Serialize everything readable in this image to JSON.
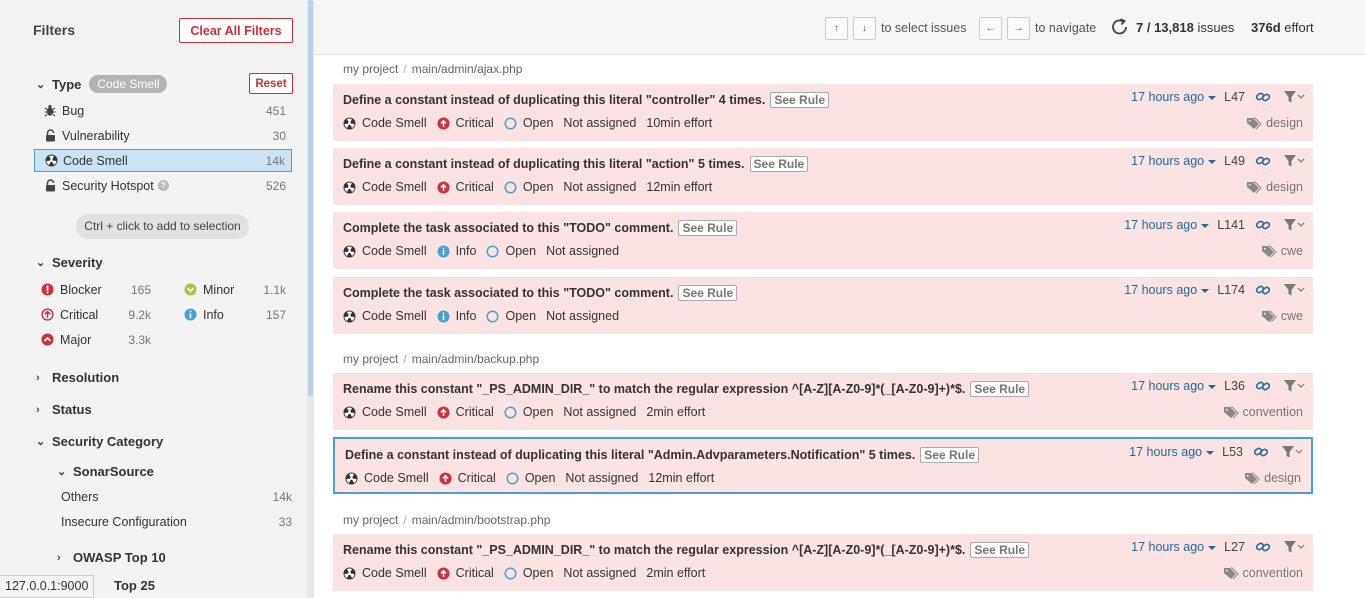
{
  "sidebar": {
    "title": "Filters",
    "clear_label": "Clear All Filters",
    "type": {
      "title": "Type",
      "tag": "Code Smell",
      "reset_label": "Reset",
      "items": [
        {
          "label": "Bug",
          "count": "451",
          "icon": "bug-icon"
        },
        {
          "label": "Vulnerability",
          "count": "30",
          "icon": "lock-icon"
        },
        {
          "label": "Code Smell",
          "count": "14k",
          "icon": "code-smell-icon"
        },
        {
          "label": "Security Hotspot",
          "count": "526",
          "icon": "lock-icon"
        }
      ],
      "hint": "Ctrl + click to add to selection"
    },
    "severity": {
      "title": "Severity",
      "items": [
        {
          "label": "Blocker",
          "count": "165"
        },
        {
          "label": "Minor",
          "count": "1.1k"
        },
        {
          "label": "Critical",
          "count": "9.2k"
        },
        {
          "label": "Info",
          "count": "157"
        },
        {
          "label": "Major",
          "count": "3.3k"
        }
      ]
    },
    "resolution_title": "Resolution",
    "status_title": "Status",
    "security_category": {
      "title": "Security Category",
      "sonarsource": {
        "title": "SonarSource",
        "items": [
          {
            "label": "Others",
            "count": "14k"
          },
          {
            "label": "Insecure Configuration",
            "count": "33"
          }
        ]
      },
      "owasp_title": "OWASP Top 10",
      "top25_title": "Top 25"
    },
    "url_tip": "127.0.0.1:9000"
  },
  "topbar": {
    "up_key": "↑",
    "down_key": "↓",
    "select_hint": "to select issues",
    "left_key": "←",
    "right_key": "→",
    "navigate_hint": "to navigate",
    "issues_count": "7 / 13,818",
    "issues_label": "issues",
    "effort_value": "376d",
    "effort_label": "effort"
  },
  "groups": [
    {
      "project": "my project",
      "file": "main/admin/ajax.php",
      "issues": [
        {
          "message": "Define a constant instead of duplicating this literal \"controller\" 4 times.",
          "type": "Code Smell",
          "severity": "Critical",
          "status": "Open",
          "assignee": "Not assigned",
          "effort": "10min effort",
          "ago": "17 hours ago",
          "line": "L47",
          "tag": "design"
        },
        {
          "message": "Define a constant instead of duplicating this literal \"action\" 5 times.",
          "type": "Code Smell",
          "severity": "Critical",
          "status": "Open",
          "assignee": "Not assigned",
          "effort": "12min effort",
          "ago": "17 hours ago",
          "line": "L49",
          "tag": "design"
        },
        {
          "message": "Complete the task associated to this \"TODO\" comment.",
          "type": "Code Smell",
          "severity": "Info",
          "status": "Open",
          "assignee": "Not assigned",
          "effort": "",
          "ago": "17 hours ago",
          "line": "L141",
          "tag": "cwe"
        },
        {
          "message": "Complete the task associated to this \"TODO\" comment.",
          "type": "Code Smell",
          "severity": "Info",
          "status": "Open",
          "assignee": "Not assigned",
          "effort": "",
          "ago": "17 hours ago",
          "line": "L174",
          "tag": "cwe"
        }
      ]
    },
    {
      "project": "my project",
      "file": "main/admin/backup.php",
      "issues": [
        {
          "message": "Rename this constant \"_PS_ADMIN_DIR_\" to match the regular expression ^[A-Z][A-Z0-9]*(_[A-Z0-9]+)*$.",
          "type": "Code Smell",
          "severity": "Critical",
          "status": "Open",
          "assignee": "Not assigned",
          "effort": "2min effort",
          "ago": "17 hours ago",
          "line": "L36",
          "tag": "convention"
        },
        {
          "message": "Define a constant instead of duplicating this literal \"Admin.Advparameters.Notification\" 5 times.",
          "type": "Code Smell",
          "severity": "Critical",
          "status": "Open",
          "assignee": "Not assigned",
          "effort": "12min effort",
          "ago": "17 hours ago",
          "line": "L53",
          "tag": "design"
        }
      ]
    },
    {
      "project": "my project",
      "file": "main/admin/bootstrap.php",
      "issues": [
        {
          "message": "Rename this constant \"_PS_ADMIN_DIR_\" to match the regular expression ^[A-Z][A-Z0-9]*(_[A-Z0-9]+)*$.",
          "type": "Code Smell",
          "severity": "Critical",
          "status": "Open",
          "assignee": "Not assigned",
          "effort": "2min effort",
          "ago": "17 hours ago",
          "line": "L27",
          "tag": "convention"
        }
      ]
    }
  ],
  "see_rule_label": "See Rule",
  "colors": {
    "critical": "#d02f3a",
    "info": "#4b9fd5",
    "selected_border": "#4b9fd5",
    "issue_bg": "#fbe3e3",
    "link": "#236a97"
  }
}
